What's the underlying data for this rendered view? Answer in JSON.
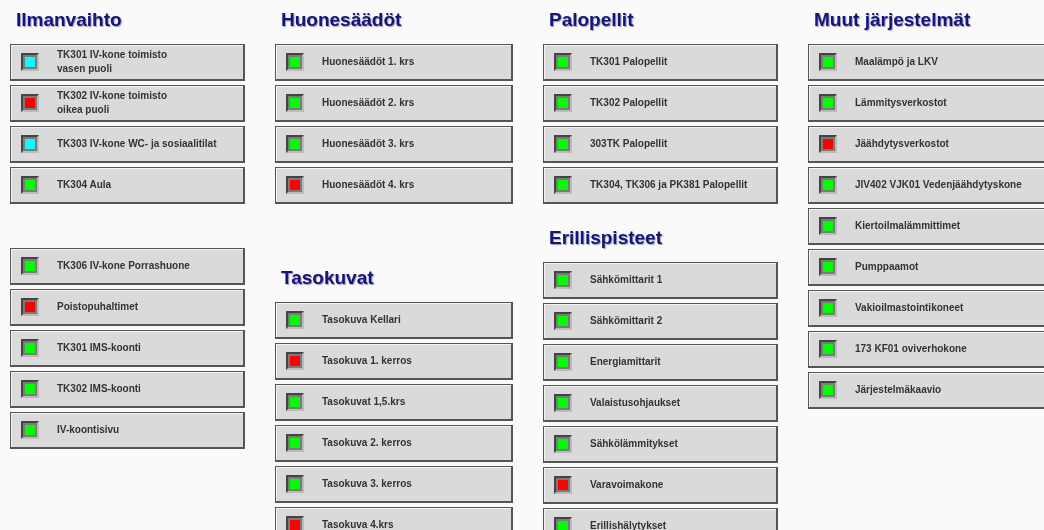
{
  "columns": [
    {
      "sections": [
        {
          "title": "Ilmanvaihto",
          "items": [
            {
              "label": "TK301 IV-kone toimisto\nvasen puoli",
              "color": "#00ffff"
            },
            {
              "label": "TK302 IV-kone toimisto\noikea puoli",
              "color": "#ff0000"
            },
            {
              "label": "TK303 IV-kone WC- ja sosiaalitilat",
              "color": "#00ffff"
            },
            {
              "label": "TK304 Aula",
              "color": "#00ff00"
            }
          ]
        },
        {
          "items": [
            {
              "label": "TK306 IV-kone Porrashuone",
              "color": "#00ff00"
            },
            {
              "label": "Poistopuhaltimet",
              "color": "#ff0000"
            },
            {
              "label": "TK301 IMS-koonti",
              "color": "#00ff00"
            },
            {
              "label": "TK302 IMS-koonti",
              "color": "#00ff00"
            },
            {
              "label": "IV-koontisivu",
              "color": "#00ff00"
            }
          ]
        }
      ]
    },
    {
      "sections": [
        {
          "title": "Huonesäädöt",
          "items": [
            {
              "label": "Huonesäädöt 1. krs",
              "color": "#00ff00"
            },
            {
              "label": "Huonesäädöt 2. krs",
              "color": "#00ff00"
            },
            {
              "label": "Huonesäädöt 3. krs",
              "color": "#00ff00"
            },
            {
              "label": "Huonesäädöt 4. krs",
              "color": "#ff0000"
            }
          ]
        },
        {
          "title": "Tasokuvat",
          "items": [
            {
              "label": "Tasokuva Kellari",
              "color": "#00ff00"
            },
            {
              "label": "Tasokuva 1. kerros",
              "color": "#ff0000"
            },
            {
              "label": "Tasokuvat 1,5.krs",
              "color": "#00ff00"
            },
            {
              "label": "Tasokuva 2. kerros",
              "color": "#00ff00"
            },
            {
              "label": "Tasokuva 3. kerros",
              "color": "#00ff00"
            },
            {
              "label": "Tasokuva 4.krs",
              "color": "#ff0000"
            }
          ]
        }
      ]
    },
    {
      "sections": [
        {
          "title": "Palopellit",
          "items": [
            {
              "label": "TK301 Palopellit",
              "color": "#00ff00"
            },
            {
              "label": "TK302 Palopellit",
              "color": "#00ff00"
            },
            {
              "label": "303TK Palopellit",
              "color": "#00ff00"
            },
            {
              "label": "TK304, TK306 ja PK381 Palopellit",
              "color": "#00ff00"
            }
          ]
        },
        {
          "title": "Erillispisteet",
          "items": [
            {
              "label": "Sähkömittarit 1",
              "color": "#00ff00"
            },
            {
              "label": "Sähkömittarit 2",
              "color": "#00ff00"
            },
            {
              "label": "Energiamittarit",
              "color": "#00ff00"
            },
            {
              "label": "Valaistusohjaukset",
              "color": "#00ff00"
            },
            {
              "label": "Sähkölämmitykset",
              "color": "#00ff00"
            },
            {
              "label": "Varavoimakone",
              "color": "#ff0000"
            },
            {
              "label": "Erillishälytykset",
              "color": "#00ff00"
            }
          ]
        }
      ]
    },
    {
      "sections": [
        {
          "title": "Muut järjestelmät",
          "items": [
            {
              "label": "Maalämpö ja LKV",
              "color": "#00ff00"
            },
            {
              "label": "Lämmitysverkostot",
              "color": "#00ff00"
            },
            {
              "label": "Jäähdytysverkostot",
              "color": "#ff0000"
            },
            {
              "label": "JIV402 VJK01 Vedenjäähdytyskone",
              "color": "#00ff00"
            },
            {
              "label": "Kiertoilmalämmittimet",
              "color": "#00ff00"
            },
            {
              "label": "Pumppaamot",
              "color": "#00ff00"
            },
            {
              "label": "Vakioilmastointikoneet",
              "color": "#00ff00"
            },
            {
              "label": "173 KF01 oviverhokone",
              "color": "#00ff00"
            },
            {
              "label": "Järjestelmäkaavio",
              "color": "#00ff00"
            }
          ]
        }
      ]
    }
  ]
}
